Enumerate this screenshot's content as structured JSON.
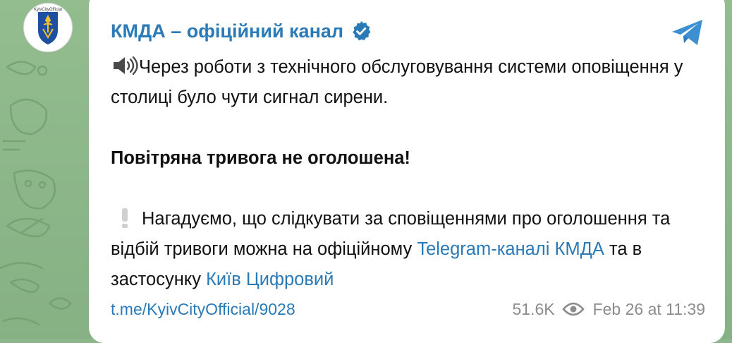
{
  "channel": {
    "name": "КМДА – офіційний канал",
    "avatar_text": "KyivCityOfficial",
    "verified_icon": "verified-badge-icon",
    "share_icon": "telegram-share-icon",
    "accent_color": "#2a7ab8"
  },
  "message": {
    "line1_emoji": "speaker-icon",
    "line1": "Через роботи з технічного обслуговування системи оповіщення у столиці було чути сигнал сирени.",
    "bold_line": "Повітряна тривога не оголошена!",
    "line3_emoji": "exclamation-icon",
    "line3_text": "Нагадуємо, що слідкувати за сповіщеннями про оголошення та відбій тривоги можна на офіційному",
    "link1": "Telegram-каналі КМДА",
    "connector": "та в застосунку",
    "link2": "Київ Цифровий"
  },
  "footer": {
    "post_link": "t.me/KyivCityOfficial/9028",
    "views": "51.6K",
    "views_icon": "eye-icon",
    "timestamp": "Feb 26 at 11:39"
  }
}
